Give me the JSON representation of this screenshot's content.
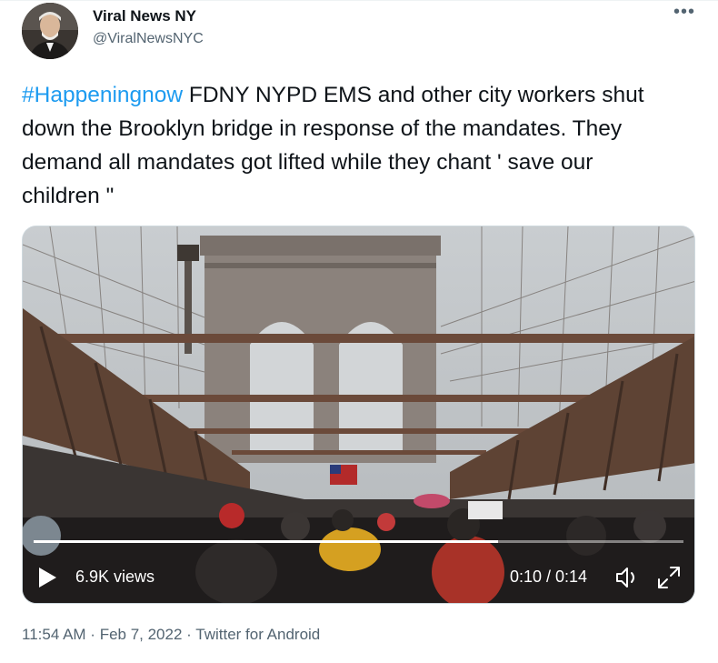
{
  "author": {
    "display_name": "Viral News NY",
    "handle": "@ViralNewsNYC",
    "avatar_icon": "profile-photo-icon"
  },
  "menu": {
    "more_icon": "more-horizontal-icon",
    "more_label": "•••"
  },
  "tweet": {
    "hashtag": "#Happeningnow",
    "text": " FDNY NYPD EMS and other city workers shut down the Brooklyn bridge in response of the mandates. They demand all mandates got lifted while they chant ' save our children \""
  },
  "video": {
    "views": "6.9K views",
    "time": "0:10 / 0:14",
    "progress_fraction": 0.714,
    "play_icon": "play-icon",
    "volume_icon": "volume-muted-icon",
    "fullscreen_icon": "fullscreen-icon"
  },
  "footer": {
    "time": "11:54 AM",
    "sep1": " · ",
    "date": "Feb 7, 2022",
    "sep2": " · ",
    "source": "Twitter for Android"
  },
  "colors": {
    "link": "#1d9bf0",
    "text": "#0f1419",
    "muted": "#536471"
  }
}
